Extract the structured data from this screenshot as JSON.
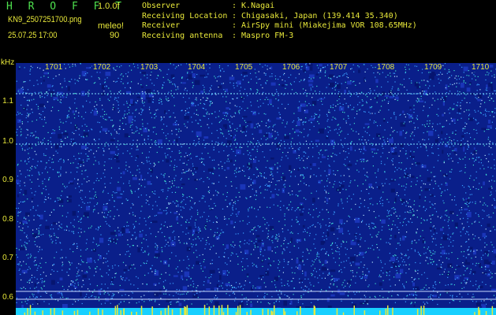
{
  "header": {
    "brand": "H R O F F T",
    "version": "1.0.0f",
    "filename": "KN9_2507251700.png",
    "datetime": "25.07.25 17:00",
    "meleo_label": "meleo!",
    "meleo_value": "90"
  },
  "info": [
    {
      "key": "Observer",
      "value": ": K.Nagai"
    },
    {
      "key": "Receiving Location",
      "value": ": Chigasaki, Japan (139.414 35.340)"
    },
    {
      "key": "Receiver",
      "value": ": AirSpy mini (Miakejima VOR 108.65MHz)"
    },
    {
      "key": "Receiving antenna",
      "value": ": Maspro FM-3"
    }
  ],
  "axis": {
    "unit": "kHz",
    "y_ticks": [
      "1.1",
      "1.0",
      "0.9",
      "0.8",
      "0.7",
      "0.6"
    ],
    "columns": [
      "1701",
      "1702",
      "1703",
      "1704",
      "1705",
      "1706",
      "1707",
      "1708",
      "1709",
      "1710"
    ]
  },
  "colors": {
    "background": "#000000",
    "label_text": "#e8e83a",
    "brand_text": "#4ee04e",
    "spectrogram_base": "#0a1f8a",
    "noise_light": "#3aa0ff",
    "noise_cyan": "#40e0d0",
    "bottom_bar_cyan": "#18d0ff",
    "bottom_bar_yellow": "#e8e83a"
  }
}
